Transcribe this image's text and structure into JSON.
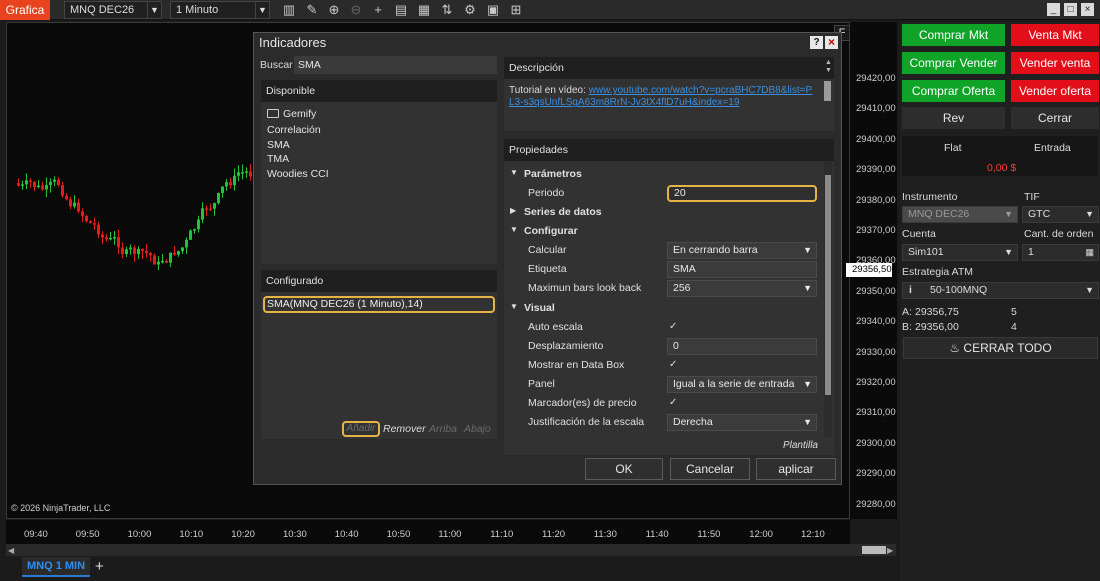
{
  "toolbar": {
    "title": "Grafica",
    "instrument": "MNQ DEC26",
    "interval": "1 Minuto",
    "icons": [
      "bar-type-icon",
      "draw-icon",
      "zoom-in-icon",
      "zoom-out-icon",
      "crosshair-icon",
      "properties-icon",
      "data-box-icon",
      "trade-icon",
      "strategies-icon",
      "indicators-icon"
    ],
    "window_buttons": [
      "_",
      "□",
      "×"
    ]
  },
  "chart": {
    "label_f": "F",
    "copyright": "© 2026 NinjaTrader, LLC",
    "price_ticks": [
      "29420,00",
      "29410,00",
      "29400,00",
      "29390,00",
      "29380,00",
      "29370,00",
      "29360,00",
      "29350,00",
      "29340,00",
      "29330,00",
      "29320,00",
      "29310,00",
      "29300,00",
      "29290,00",
      "29280,00"
    ],
    "current_price": "29356,50",
    "time_ticks": [
      "09:40",
      "09:50",
      "10:00",
      "10:10",
      "10:20",
      "10:30",
      "10:40",
      "10:50",
      "11:00",
      "11:10",
      "11:20",
      "11:30",
      "11:40",
      "11:50",
      "12:00",
      "12:10"
    ],
    "colors": {
      "up": "#22c33a",
      "down": "#e21b1b"
    }
  },
  "tab": {
    "label": "MNQ 1 MIN",
    "add": "+"
  },
  "dialog": {
    "title": "Indicadores",
    "help": "?",
    "close": "×",
    "search_label": "Buscar",
    "search_value": "SMA",
    "available_head": "Disponible",
    "available": [
      {
        "label": "Gemify",
        "folder": true
      },
      {
        "label": "Correlación"
      },
      {
        "label": "SMA"
      },
      {
        "label": "TMA"
      },
      {
        "label": "Woodies CCI"
      }
    ],
    "configured_head": "Configurado",
    "configured_item": "SMA(MNQ DEC26 (1 Minuto),14)",
    "actions": {
      "add": "Añadir",
      "remove": "Remover",
      "up": "Arriba",
      "down": "Abajo"
    },
    "description_head": "Descripción",
    "description_prefix": "Tutorial en vídeo: ",
    "description_link": "www.youtube.com/watch?v=pcraBHC7DB8&list=PL3-s3qsUnfLSgA63m8RrN-Jv3tX4flD7uH&index=19",
    "properties_head": "Propiedades",
    "sections": {
      "params": "Parámetros",
      "series": "Series de datos",
      "config": "Configurar",
      "visual": "Visual"
    },
    "props": {
      "period_label": "Periodo",
      "period_value": "20",
      "calc_label": "Calcular",
      "calc_value": "En cerrando barra",
      "tag_label": "Etiqueta",
      "tag_value": "SMA",
      "maxbars_label": "Maximun bars look back",
      "maxbars_value": "256",
      "autoscale_label": "Auto escala",
      "shift_label": "Desplazamiento",
      "shift_value": "0",
      "databox_label": "Mostrar en Data Box",
      "panel_label": "Panel",
      "panel_value": "Igual a la serie de entrada",
      "price_marker_label": "Marcador(es) de precio",
      "scale_just_label": "Justificación de la escala",
      "scale_just_value": "Derecha"
    },
    "template": "Plantilla",
    "ok": "OK",
    "cancel": "Cancelar",
    "apply": "aplicar"
  },
  "right": {
    "buy_mkt": "Comprar Mkt",
    "sell_mkt": "Venta Mkt",
    "buy_stop": "Comprar Vender",
    "sell_stop": "Vender venta",
    "buy_bid": "Comprar Oferta",
    "sell_offer": "Vender oferta",
    "rev": "Rev",
    "close": "Cerrar",
    "flat": "Flat",
    "entry": "Entrada",
    "pnl": "0,00 $",
    "instrument_label": "Instrumento",
    "instrument_value": "MNQ DEC26",
    "tif_label": "TIF",
    "tif_value": "GTC",
    "account_label": "Cuenta",
    "account_value": "Sim101",
    "qty_label": "Cant. de orden",
    "qty_value": "1",
    "atm_label": "Estrategia ATM",
    "atm_value": "50-100MNQ",
    "ask_label": "A:",
    "ask_price": "29356,75",
    "ask_size": "5",
    "bid_label": "B:",
    "bid_price": "29356,00",
    "bid_size": "4",
    "close_all": "CERRAR TODO"
  }
}
